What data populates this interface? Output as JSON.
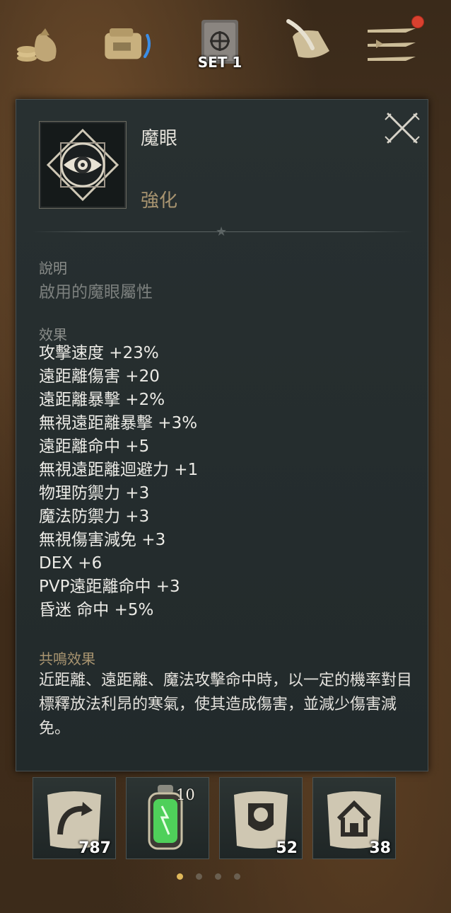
{
  "topbar": {
    "set_label": "SET 1",
    "icons": [
      "coin-bag-icon",
      "inventory-bag-icon",
      "skill-book-icon",
      "quest-scroll-icon",
      "menu-icon"
    ]
  },
  "item": {
    "name": "魔眼",
    "type": "強化",
    "icon": "magic-eye-icon"
  },
  "sections": {
    "description_label": "說明",
    "description_text": "啟用的魔眼屬性",
    "effects_label": "效果",
    "resonance_label": "共鳴效果",
    "resonance_text": "近距離、遠距離、魔法攻擊命中時，以一定的機率對目標釋放法利昂的寒氣，使其造成傷害，並減少傷害減免。"
  },
  "effects": [
    "攻擊速度 +23%",
    "遠距離傷害 +20",
    "遠距離暴擊 +2%",
    "無視遠距離暴擊 +3%",
    "遠距離命中 +5",
    "無視遠距離迴避力 +1",
    "物理防禦力 +3",
    "魔法防禦力 +3",
    "無視傷害減免 +3",
    "DEX +6",
    "PVP遠距離命中 +3",
    "昏迷 命中 +5%"
  ],
  "bottom_slots": [
    {
      "icon": "return-scroll-icon",
      "count": "787"
    },
    {
      "icon": "green-potion-icon",
      "level": "10"
    },
    {
      "icon": "lion-scroll-icon",
      "count": "52"
    },
    {
      "icon": "home-scroll-icon",
      "count": "38"
    }
  ],
  "colors": {
    "panel_bg": "#262d2e",
    "label_gold": "#a89470",
    "label_gray": "#8b8e8b",
    "text_white": "#ecebe6",
    "active_dot": "#e0b85a"
  }
}
